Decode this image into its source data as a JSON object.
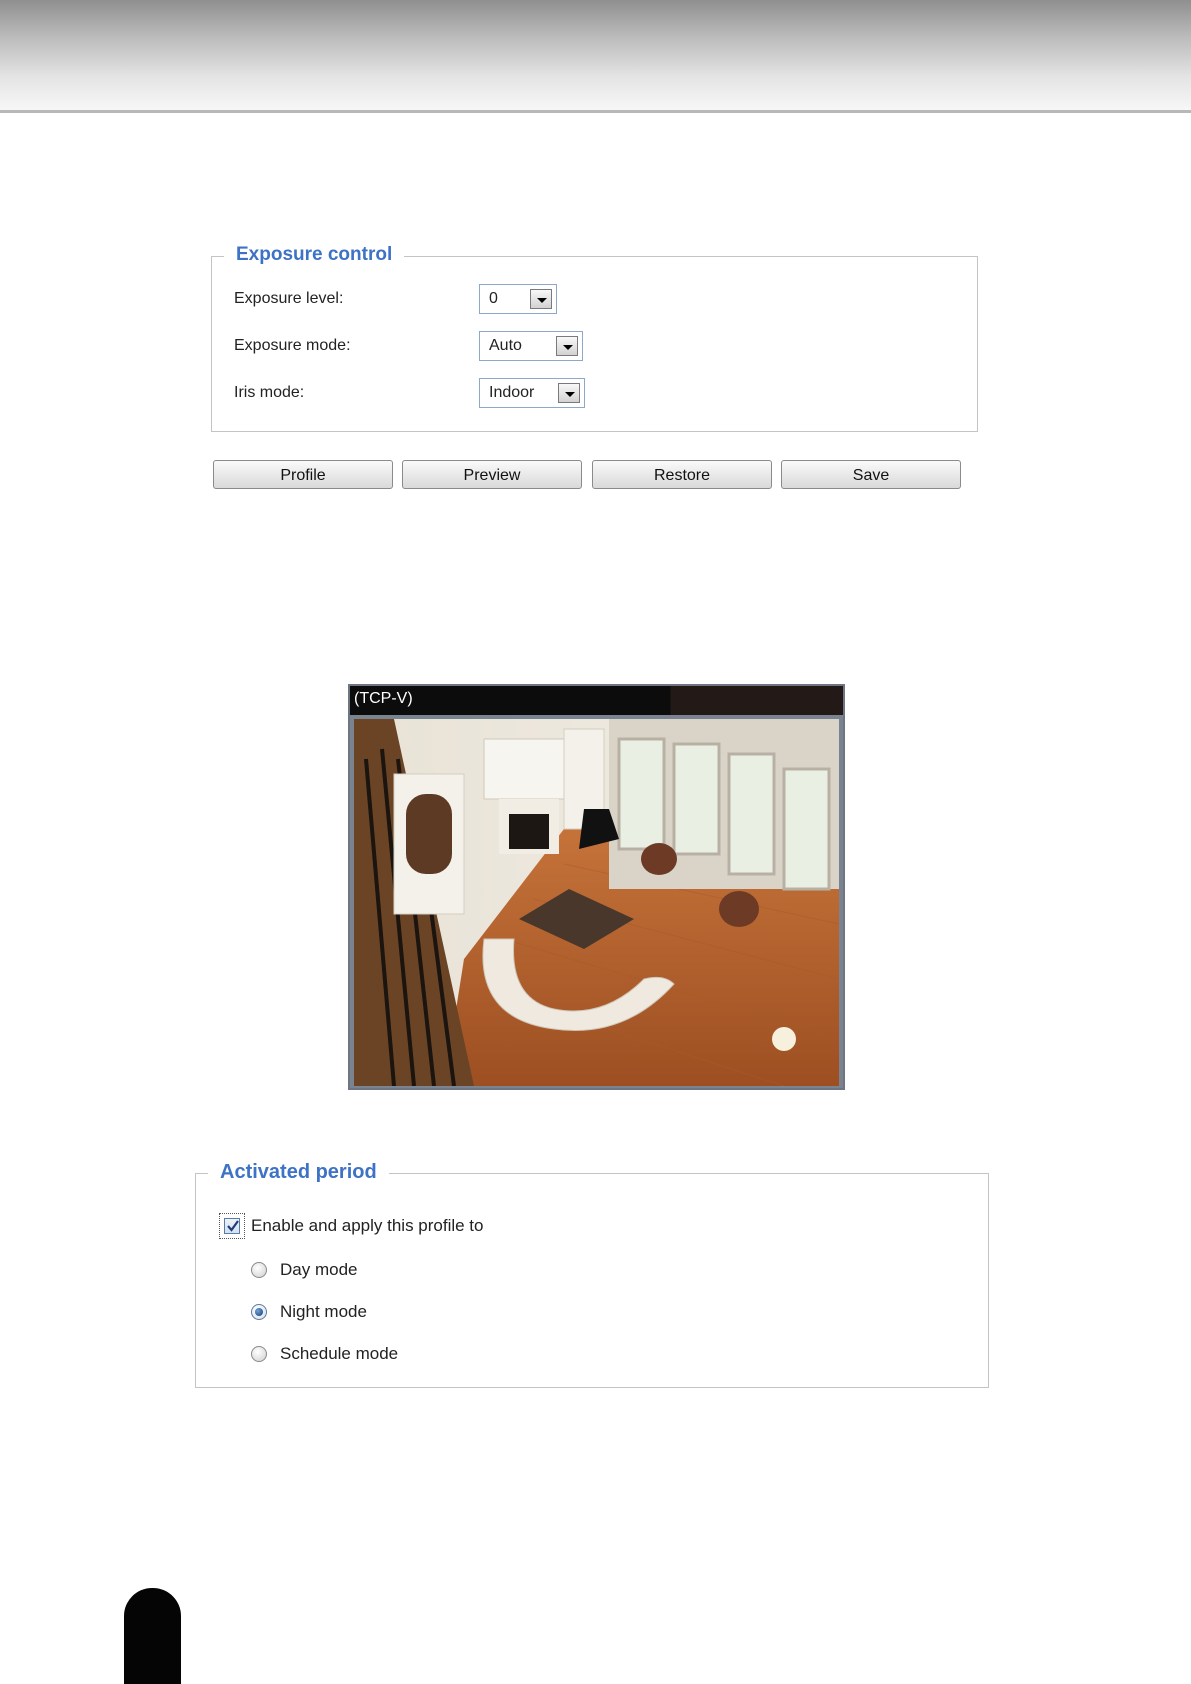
{
  "exposure_control": {
    "legend": "Exposure control",
    "fields": [
      {
        "label": "Exposure level:",
        "value": "0"
      },
      {
        "label": "Exposure mode:",
        "value": "Auto"
      },
      {
        "label": "Iris mode:",
        "value": "Indoor"
      }
    ]
  },
  "buttons": {
    "profile": "Profile",
    "preview": "Preview",
    "restore": "Restore",
    "save": "Save"
  },
  "video": {
    "title": "(TCP-V)"
  },
  "activated_period": {
    "legend": "Activated period",
    "enable_label": "Enable and apply this profile to",
    "enable_checked": true,
    "modes": [
      {
        "label": "Day mode",
        "selected": false
      },
      {
        "label": "Night mode",
        "selected": true
      },
      {
        "label": "Schedule mode",
        "selected": false
      }
    ]
  }
}
